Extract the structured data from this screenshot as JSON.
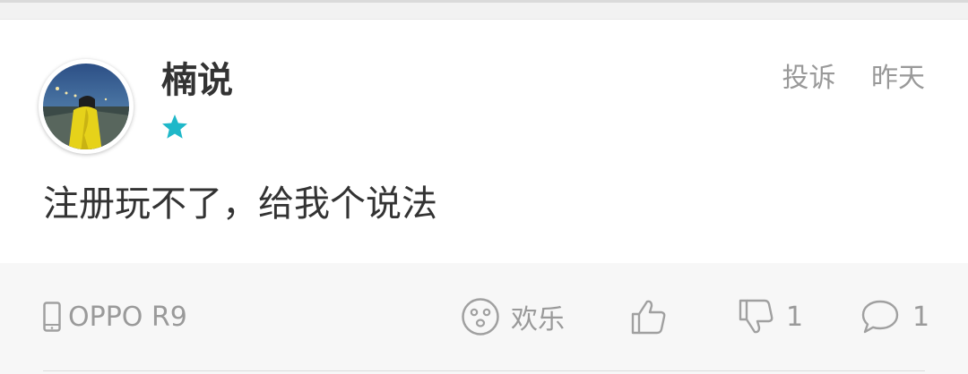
{
  "post": {
    "author": "楠说",
    "report_label": "投诉",
    "time": "昨天",
    "content": "注册玩不了，给我个说法"
  },
  "footer": {
    "device": "OPPO R9",
    "mood_label": "欢乐",
    "dislike_count": "1",
    "comment_count": "1"
  },
  "colors": {
    "star": "#1fb8c9",
    "text_main": "#333333",
    "text_secondary": "#999999",
    "footer_bg": "#f7f7f7"
  },
  "icons": {
    "avatar": "user-avatar-photo",
    "badge": "star-icon",
    "device": "phone-icon",
    "mood": "smiley-face-icon",
    "like": "thumbs-up-icon",
    "dislike": "thumbs-down-icon",
    "comment": "comment-bubble-icon"
  }
}
